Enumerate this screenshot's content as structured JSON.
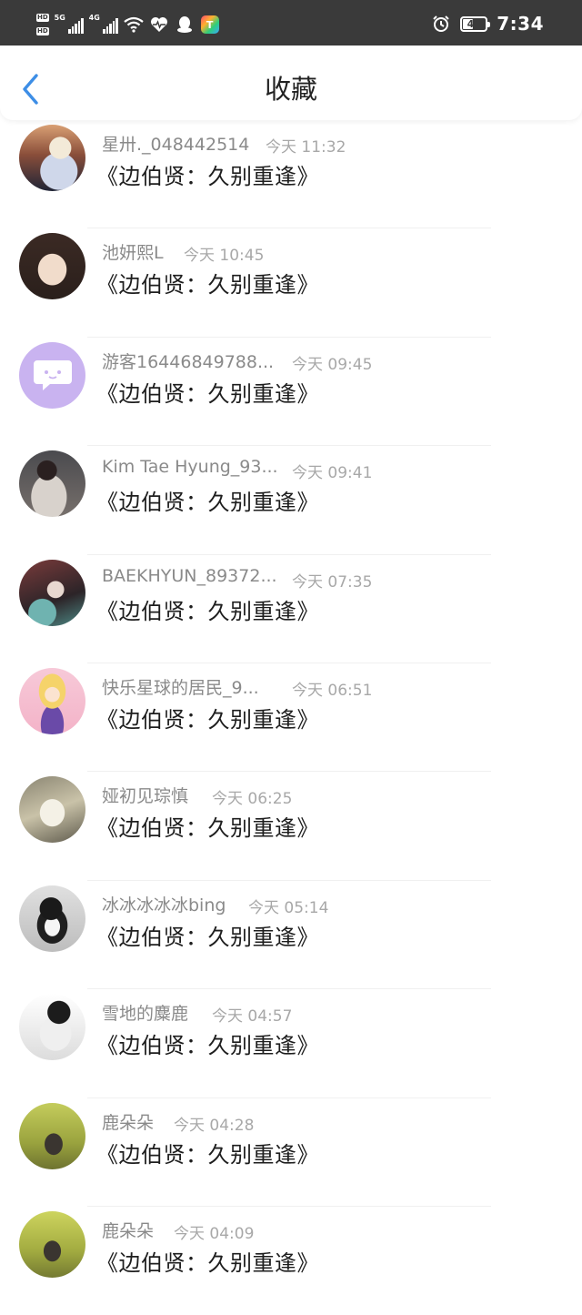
{
  "status_bar": {
    "hd_badge": "HD",
    "network_5g": "5G",
    "network_4g": "4G",
    "battery": "41",
    "time": "7:34",
    "icons": [
      "wifi-icon",
      "health-heart-icon",
      "qq-penguin-icon",
      "colorful-app-icon",
      "alarm-clock-icon"
    ]
  },
  "header": {
    "title": "收藏",
    "back_icon": "chevron-left-icon",
    "accent": "#3d8ee6"
  },
  "favorites": [
    {
      "user": "星卅._048442514",
      "time": "今天 11:32",
      "title": "《边伯贤：久别重逢》"
    },
    {
      "user": "池妍熙L",
      "time": "今天 10:45",
      "title": "《边伯贤：久别重逢》"
    },
    {
      "user": "游客16446849788...",
      "time": "今天 09:45",
      "title": "《边伯贤：久别重逢》"
    },
    {
      "user": "Kim Tae Hyung_93...",
      "time": "今天 09:41",
      "title": "《边伯贤：久别重逢》"
    },
    {
      "user": "BAEKHYUN_89372...",
      "time": "今天 07:35",
      "title": "《边伯贤：久别重逢》"
    },
    {
      "user": "快乐星球的居民_9...",
      "time": "今天 06:51",
      "title": "《边伯贤：久别重逢》"
    },
    {
      "user": "娅初见琮慎",
      "time": "今天 06:25",
      "title": "《边伯贤：久别重逢》"
    },
    {
      "user": "冰冰冰冰冰bing",
      "time": "今天 05:14",
      "title": "《边伯贤：久别重逢》"
    },
    {
      "user": "雪地的麋鹿",
      "time": "今天 04:57",
      "title": "《边伯贤：久别重逢》"
    },
    {
      "user": "鹿朵朵",
      "time": "今天 04:28",
      "title": "《边伯贤：久别重逢》"
    },
    {
      "user": "鹿朵朵",
      "time": "今天 04:09",
      "title": "《边伯贤：久别重逢》"
    }
  ]
}
